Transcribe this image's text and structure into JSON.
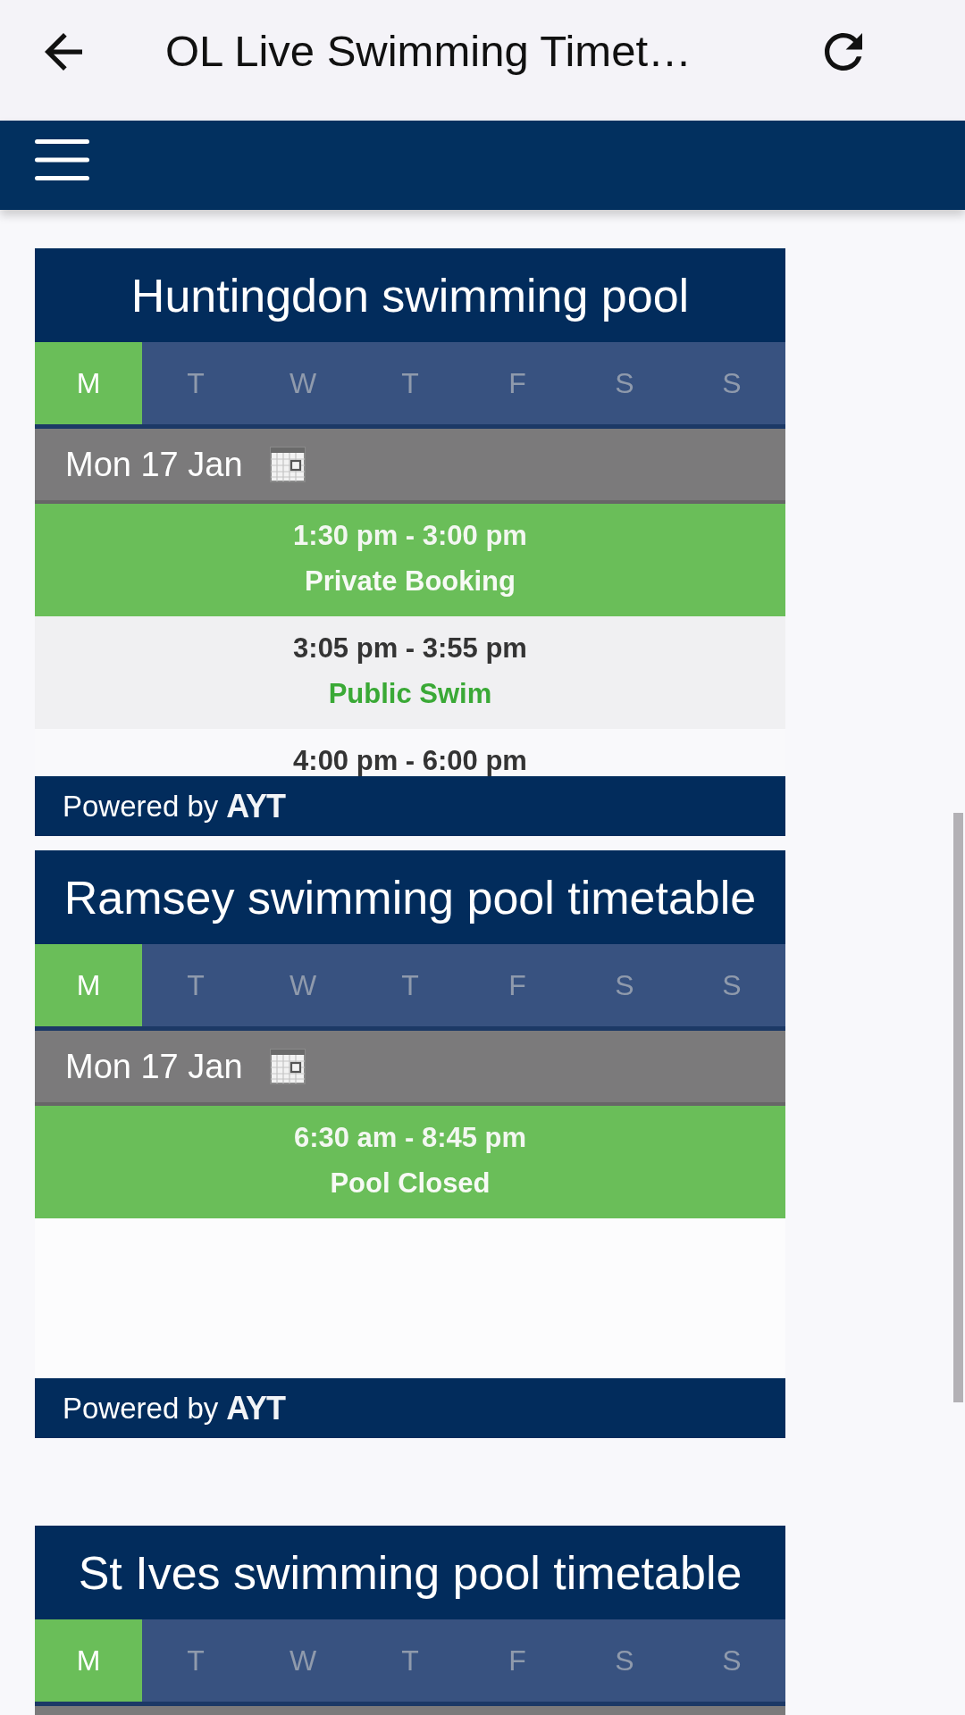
{
  "app_bar": {
    "title": "OL Live Swimming Timet…"
  },
  "timetables": [
    {
      "title": "Huntingdon swimming pool",
      "days": [
        {
          "label": "M",
          "selected": true
        },
        {
          "label": "T",
          "selected": false
        },
        {
          "label": "W",
          "selected": false
        },
        {
          "label": "T",
          "selected": false
        },
        {
          "label": "F",
          "selected": false
        },
        {
          "label": "S",
          "selected": false
        },
        {
          "label": "S",
          "selected": false
        }
      ],
      "date": "Mon 17 Jan",
      "sessions": [
        {
          "time": "1:30 pm - 3:00 pm",
          "activity": "Private Booking",
          "current": true
        },
        {
          "time": "3:05 pm - 3:55 pm",
          "activity": "Public Swim",
          "current": false
        },
        {
          "time": "4:00 pm - 6:00 pm",
          "current": false
        }
      ],
      "footer": {
        "text": "Powered by",
        "logo": "AYT"
      }
    },
    {
      "title": "Ramsey swimming pool timetable",
      "days": [
        {
          "label": "M",
          "selected": true
        },
        {
          "label": "T",
          "selected": false
        },
        {
          "label": "W",
          "selected": false
        },
        {
          "label": "T",
          "selected": false
        },
        {
          "label": "F",
          "selected": false
        },
        {
          "label": "S",
          "selected": false
        },
        {
          "label": "S",
          "selected": false
        }
      ],
      "date": "Mon 17 Jan",
      "sessions": [
        {
          "time": "6:30 am - 8:45 pm",
          "activity": "Pool Closed",
          "current": true
        }
      ],
      "footer": {
        "text": "Powered by",
        "logo": "AYT"
      }
    },
    {
      "title": "St Ives swimming pool timetable",
      "days": [
        {
          "label": "M",
          "selected": true
        },
        {
          "label": "T",
          "selected": false
        },
        {
          "label": "W",
          "selected": false
        },
        {
          "label": "T",
          "selected": false
        },
        {
          "label": "F",
          "selected": false
        },
        {
          "label": "S",
          "selected": false
        },
        {
          "label": "S",
          "selected": false
        }
      ]
    }
  ]
}
